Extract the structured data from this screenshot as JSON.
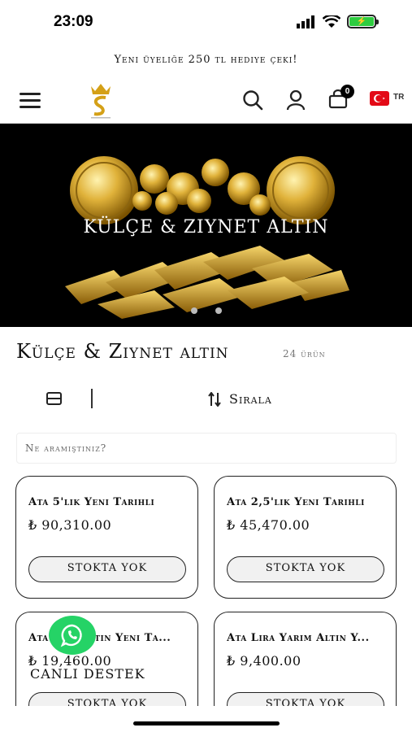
{
  "status": {
    "time": "23:09"
  },
  "promo": {
    "text": "Yeni üyeliğe 250 tl hediye çeki!"
  },
  "header": {
    "cart_count": "0",
    "language": "TR"
  },
  "banner": {
    "title": "KÜLÇE & ZIYNET ALTIN",
    "slides": 2
  },
  "category": {
    "title": "Külçe & Ziynet altın",
    "count_label": "24 ürün"
  },
  "toolbar": {
    "sort_label": "Sırala"
  },
  "search": {
    "placeholder": "Ne aramıştınız?"
  },
  "products": [
    {
      "name": "Ata 5'lik Yeni Tarihli",
      "price": "₺ 90,310.00",
      "button": "STOKTA YOK"
    },
    {
      "name": "Ata 2,5'lik Yeni Tarihli",
      "price": "₺ 45,470.00",
      "button": "STOKTA YOK"
    },
    {
      "name": "Ata Lira Altın Yeni Ta...",
      "price": "₺ 19,460.00",
      "button": "STOKTA YOK"
    },
    {
      "name": "Ata Lira Yarım Altın Y...",
      "price": "₺ 9,400.00",
      "button": "STOKTA YOK"
    }
  ],
  "support": {
    "label": "CANLI DESTEK"
  },
  "colors": {
    "whatsapp": "#25d366",
    "flag": "#e30a17",
    "gold": "#d4a017"
  }
}
